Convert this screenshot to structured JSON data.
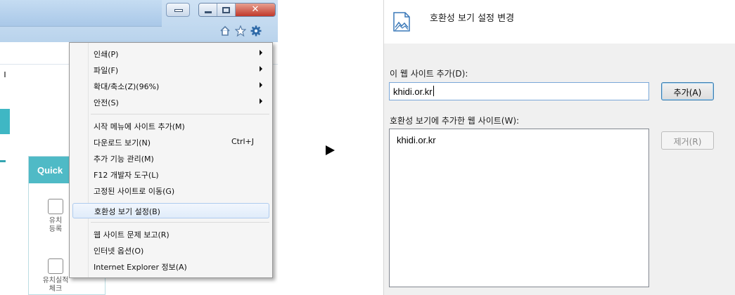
{
  "tools_menu": {
    "items": [
      {
        "label": "인쇄(P)",
        "submenu": true
      },
      {
        "label": "파일(F)",
        "submenu": true
      },
      {
        "label": "확대/축소(Z)(96%)",
        "submenu": true
      },
      {
        "label": "안전(S)",
        "submenu": true
      },
      {
        "label": "시작 메뉴에 사이트 추가(M)"
      },
      {
        "label": "다운로드 보기(N)",
        "shortcut": "Ctrl+J"
      },
      {
        "label": "추가 기능 관리(M)"
      },
      {
        "label": "F12 개발자 도구(L)"
      },
      {
        "label": "고정된 사이트로 이동(G)"
      },
      {
        "label": "호환성 보기 설정(B)",
        "highlighted": true
      },
      {
        "label": "웹 사이트 문제 보고(R)"
      },
      {
        "label": "인터넷 옵션(O)"
      },
      {
        "label": "Internet Explorer 정보(A)"
      }
    ]
  },
  "background_page": {
    "quick_title": "Quick",
    "item1": [
      "유치",
      "등록"
    ],
    "item2": [
      "유치실적",
      "체크"
    ]
  },
  "dialog": {
    "title": "호환성 보기 설정 변경",
    "add_site_label": "이 웹 사이트 추가(D):",
    "site_input_value": "khidi.or.kr",
    "add_button": "추가(A)",
    "list_label": "호환성 보기에 추가한 웹 사이트(W):",
    "list_items": [
      "khidi.or.kr"
    ],
    "remove_button": "제거(R)"
  },
  "colors": {
    "accent_teal": "#4fbac6",
    "menu_highlight": "#e0ecfa",
    "button_border": "#3c7fb1"
  }
}
